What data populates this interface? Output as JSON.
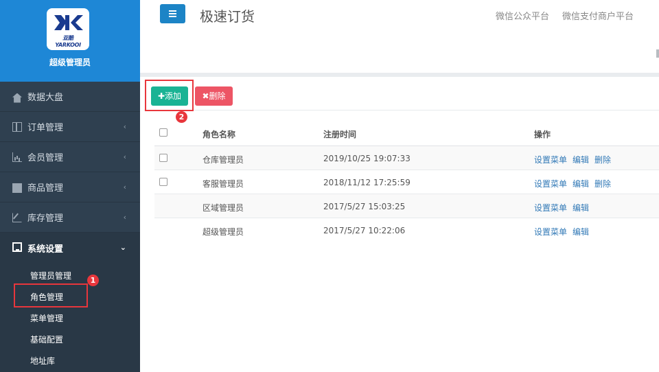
{
  "brand": {
    "logo_text": "亚酷 YARKOOI",
    "role_title": "超级管理员"
  },
  "sidebar": {
    "items": [
      {
        "label": "数据大盘",
        "icon": "home-icon"
      },
      {
        "label": "订单管理",
        "icon": "columns-icon"
      },
      {
        "label": "会员管理",
        "icon": "bar-chart-icon"
      },
      {
        "label": "商品管理",
        "icon": "envelope-icon"
      },
      {
        "label": "库存管理",
        "icon": "edit-icon"
      },
      {
        "label": "系统设置",
        "icon": "desktop-icon"
      }
    ],
    "sub_items": [
      "管理员管理",
      "角色管理",
      "菜单管理",
      "基础配置",
      "地址库"
    ]
  },
  "header": {
    "menu_icon": "hamburger-icon",
    "title": "极速订货",
    "links": [
      "微信公众平台",
      "微信支付商户平台"
    ]
  },
  "toolbar": {
    "add_label": "添加",
    "delete_label": "删除"
  },
  "table": {
    "headers": [
      "角色名称",
      "注册时间",
      "操作"
    ],
    "rows": [
      {
        "name": "仓库管理员",
        "time": "2019/10/25 19:07:33",
        "ops": [
          "设置菜单",
          "编辑",
          "删除"
        ]
      },
      {
        "name": "客服管理员",
        "time": "2018/11/12 17:25:59",
        "ops": [
          "设置菜单",
          "编辑",
          "删除"
        ]
      },
      {
        "name": "区域管理员",
        "time": "2017/5/27 15:03:25",
        "ops": [
          "设置菜单",
          "编辑"
        ]
      },
      {
        "name": "超级管理员",
        "time": "2017/5/27 10:22:06",
        "ops": [
          "设置菜单",
          "编辑"
        ]
      }
    ]
  },
  "annotations": {
    "step1": "1",
    "step2": "2"
  },
  "colors": {
    "sidebar_bg": "#2f4050",
    "brand_bg": "#1e87d6",
    "primary": "#1c84c6",
    "success": "#1ab394",
    "danger": "#ed5565",
    "link": "#337ab7",
    "annotation_red": "#e8363c"
  }
}
